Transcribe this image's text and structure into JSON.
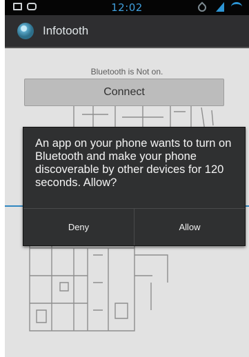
{
  "status_bar": {
    "time": "12:02",
    "left_icons": [
      "image-icon",
      "voicemail-icon"
    ],
    "right_icons": [
      "gps-icon",
      "signal-icon",
      "wifi-icon"
    ],
    "accent_color": "#2d95d4"
  },
  "app": {
    "title": "Infotooth",
    "icon": "app-globe-icon"
  },
  "main": {
    "bluetooth_status": "Bluetooth is Not on.",
    "connect_label": "Connect",
    "background_image": "floor-plan-map"
  },
  "dialog": {
    "message": "An app on your phone wants to turn on Bluetooth and make your phone discoverable by other devices for 120 seconds. Allow?",
    "deny_label": "Deny",
    "allow_label": "Allow"
  }
}
